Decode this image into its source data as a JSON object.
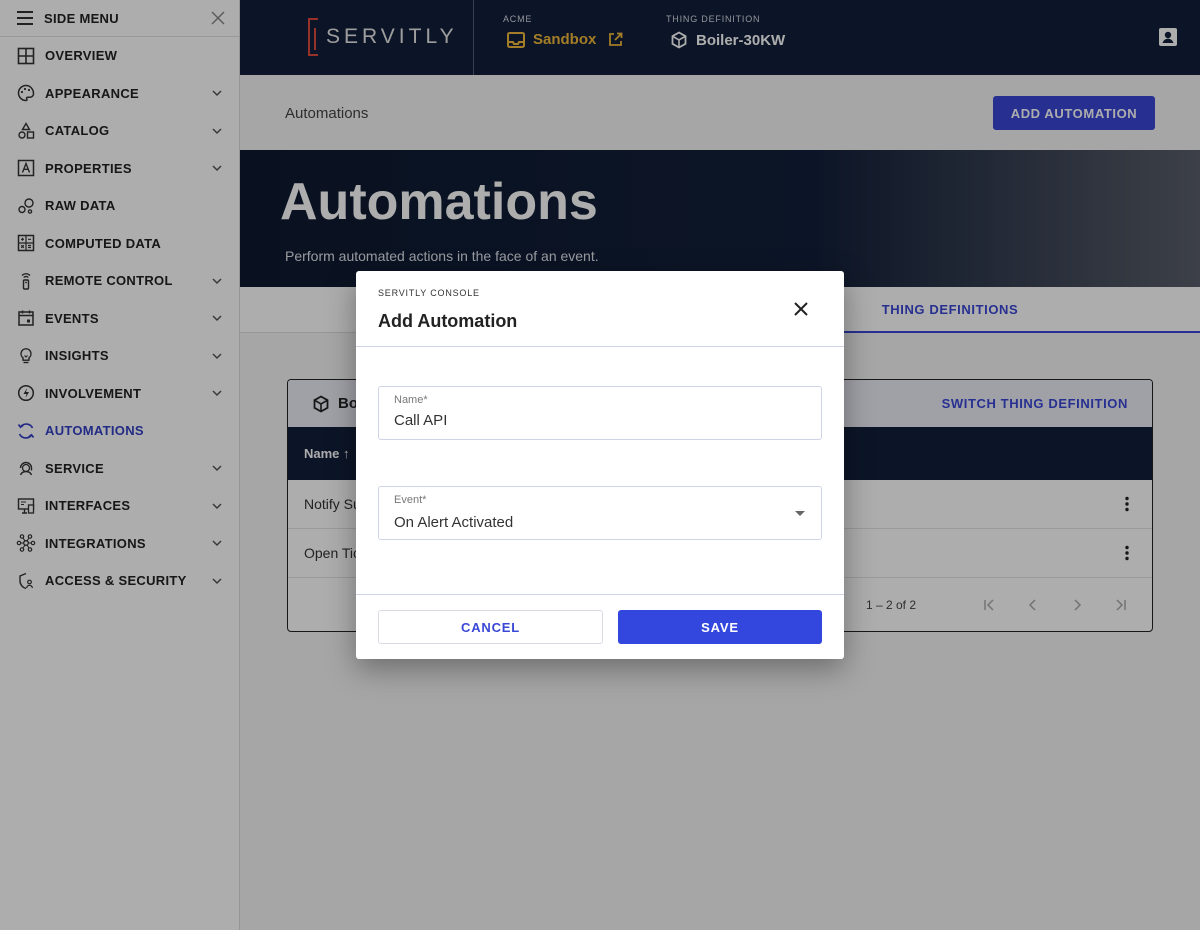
{
  "colors": {
    "accent": "#3a48d6",
    "navy": "#13203a",
    "gold": "#f0b83a",
    "logo_red": "#e04b3c"
  },
  "sidebar": {
    "header_label": "SIDE MENU",
    "items": [
      {
        "label": "OVERVIEW",
        "icon": "grid-icon",
        "expandable": false
      },
      {
        "label": "APPEARANCE",
        "icon": "palette-icon",
        "expandable": true
      },
      {
        "label": "CATALOG",
        "icon": "shapes-icon",
        "expandable": true
      },
      {
        "label": "PROPERTIES",
        "icon": "letter-box-icon",
        "expandable": true
      },
      {
        "label": "RAW DATA",
        "icon": "bubbles-icon",
        "expandable": false
      },
      {
        "label": "COMPUTED DATA",
        "icon": "calculator-icon",
        "expandable": false
      },
      {
        "label": "REMOTE CONTROL",
        "icon": "remote-icon",
        "expandable": true
      },
      {
        "label": "EVENTS",
        "icon": "calendar-icon",
        "expandable": true
      },
      {
        "label": "INSIGHTS",
        "icon": "lightbulb-icon",
        "expandable": true
      },
      {
        "label": "INVOLVEMENT",
        "icon": "bolt-circle-icon",
        "expandable": true
      },
      {
        "label": "AUTOMATIONS",
        "icon": "cycle-icon",
        "expandable": false,
        "active": true
      },
      {
        "label": "SERVICE",
        "icon": "support-agent-icon",
        "expandable": true
      },
      {
        "label": "INTERFACES",
        "icon": "devices-icon",
        "expandable": true
      },
      {
        "label": "INTEGRATIONS",
        "icon": "hub-icon",
        "expandable": true
      },
      {
        "label": "ACCESS & SECURITY",
        "icon": "shield-person-icon",
        "expandable": true
      }
    ]
  },
  "topbar": {
    "logo_text": "SERVITLY",
    "tenant_caption": "ACME",
    "tenant_value": "Sandbox",
    "thing_caption": "THING DEFINITION",
    "thing_value": "Boiler-30KW"
  },
  "page": {
    "breadcrumb": "Automations",
    "add_button": "ADD AUTOMATION",
    "hero_title": "Automations",
    "hero_subtitle": "Perform automated actions in the face of an event.",
    "tab_label": "THING DEFINITIONS"
  },
  "card": {
    "thing_name": "Bo",
    "switch_label": "SWITCH THING DEFINITION",
    "column_name": "Name ↑",
    "rows": [
      "Notify Su",
      "Open Tic"
    ],
    "pager_range": "1 – 2 of 2"
  },
  "dialog": {
    "subtitle": "SERVITLY CONSOLE",
    "title": "Add Automation",
    "name_label": "Name*",
    "name_value": "Call API",
    "event_label": "Event*",
    "event_value": "On Alert Activated",
    "cancel_label": "CANCEL",
    "save_label": "SAVE"
  }
}
